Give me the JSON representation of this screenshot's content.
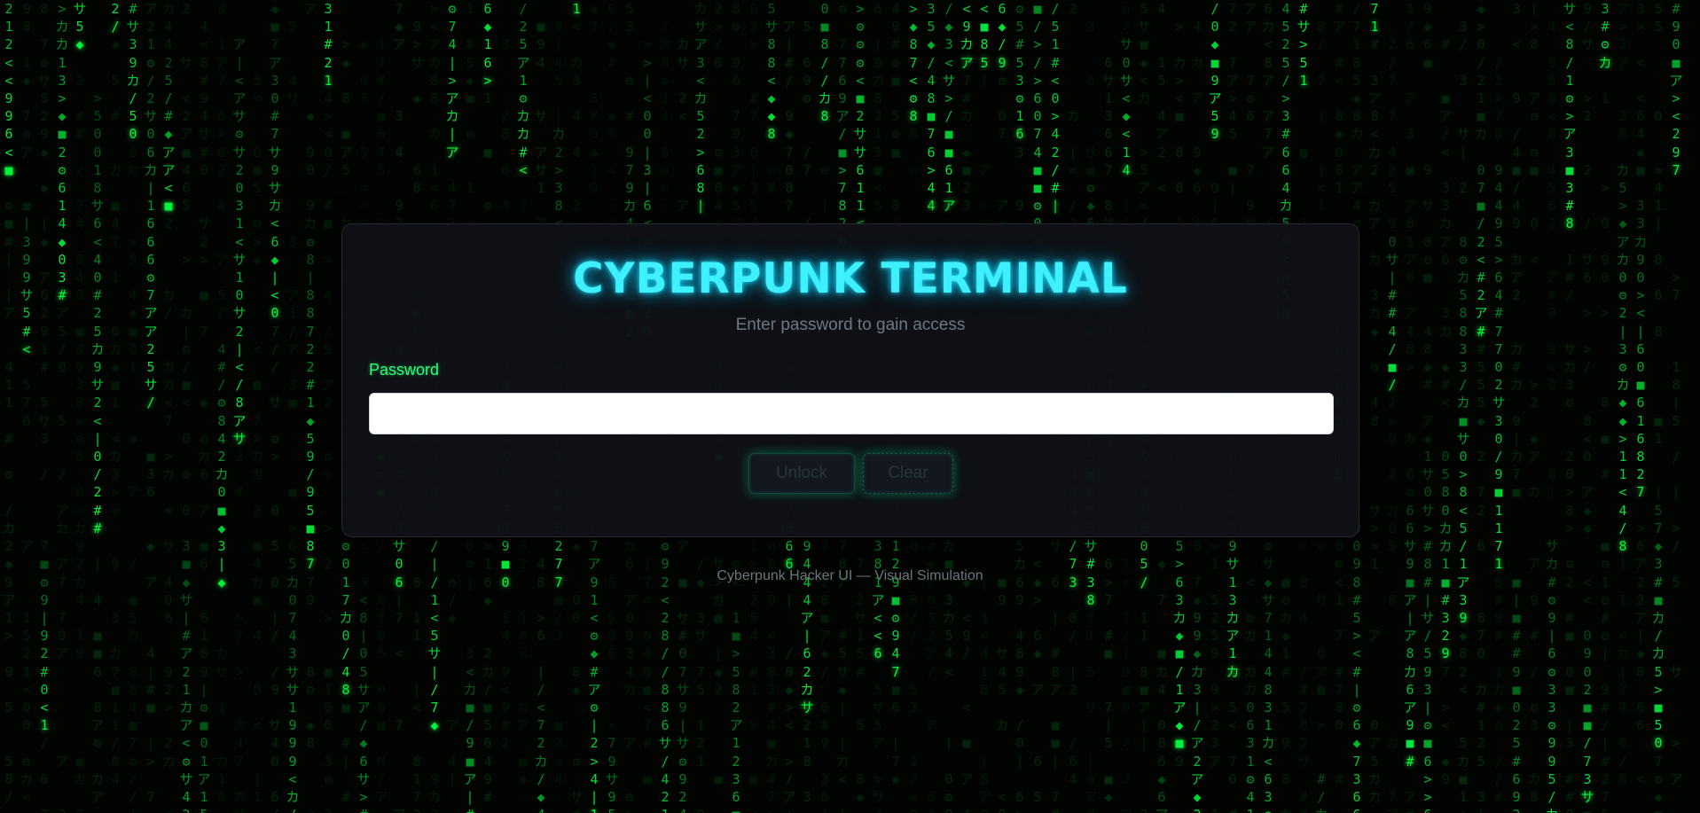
{
  "terminal": {
    "title": "CYBERPUNK TERMINAL",
    "subtitle": "Enter password to gain access",
    "password_label": "Password",
    "password_value": "",
    "password_placeholder": "",
    "unlock_label": "Unlock",
    "clear_label": "Clear"
  },
  "footer": {
    "text": "Cyberpunk Hacker UI — Visual Simulation"
  },
  "colors": {
    "background": "#020402",
    "matrix_green": "#00ff41",
    "title_cyan": "#3ff0ff",
    "label_green": "#2cff7c",
    "panel": "#0e1116"
  },
  "background_effect": {
    "glyph_set": [
      "0",
      "1",
      "2",
      "3",
      "4",
      "5",
      "6",
      "7",
      "8",
      "9",
      "ア",
      "カ",
      "サ",
      "#",
      "<",
      ">",
      "/",
      "|",
      "■",
      "◆",
      "⚙"
    ]
  }
}
